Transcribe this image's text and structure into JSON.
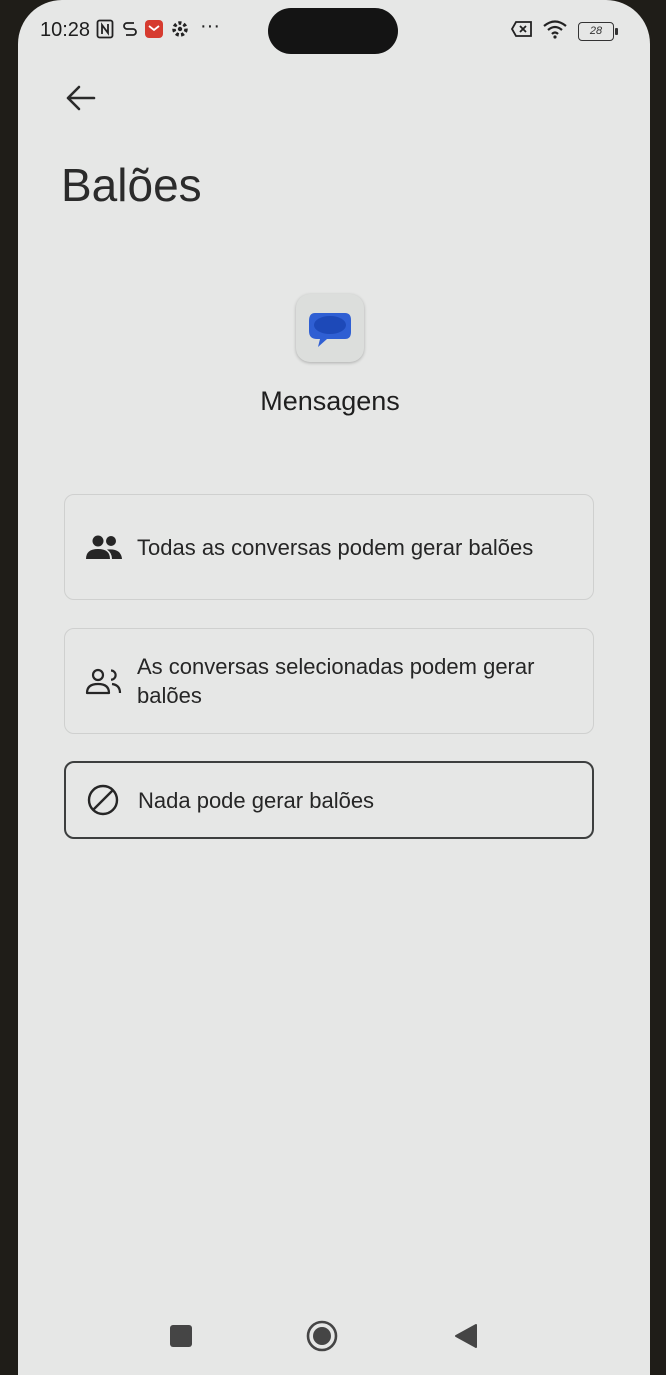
{
  "status_bar": {
    "time": "10:28",
    "battery": "28",
    "more": "···"
  },
  "header": {
    "title": "Balões"
  },
  "app": {
    "name": "Mensagens",
    "accent": "#2f5fd3"
  },
  "options": [
    {
      "label": "Todas as conversas podem gerar balões",
      "icon": "people-filled-icon",
      "selected": false
    },
    {
      "label": "As conversas selecionadas podem gerar balões",
      "icon": "people-outline-icon",
      "selected": false
    },
    {
      "label": "Nada pode gerar balões",
      "icon": "block-icon",
      "selected": true
    }
  ],
  "colors": {
    "background": "#e6e7e6",
    "text": "#262626",
    "border": "#cfd0cf",
    "selected_border": "#3d3f3f"
  }
}
